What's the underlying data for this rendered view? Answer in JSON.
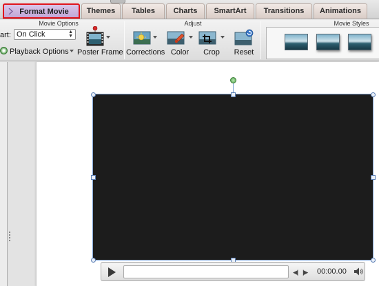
{
  "tabs": [
    {
      "label": "Format Movie",
      "active": true
    },
    {
      "label": "Themes"
    },
    {
      "label": "Tables"
    },
    {
      "label": "Charts"
    },
    {
      "label": "SmartArt"
    },
    {
      "label": "Transitions"
    },
    {
      "label": "Animations"
    }
  ],
  "groups": {
    "movie_options": "Movie Options",
    "adjust": "Adjust",
    "movie_styles": "Movie Styles"
  },
  "movie_options": {
    "start_label": "art:",
    "start_value": "On Click",
    "playback_label": "Playback Options"
  },
  "buttons": {
    "poster_frame": "Poster Frame",
    "corrections": "Corrections",
    "color": "Color",
    "crop": "Crop",
    "reset": "Reset"
  },
  "player": {
    "time": "00:00.00"
  },
  "colors": {
    "active_tab_outline": "#e0141c",
    "active_tab_fill": "#c9b1dd",
    "video_fill": "#1c1c1c",
    "selection": "#7fa4d6",
    "rotate_handle": "#4fa24a"
  }
}
